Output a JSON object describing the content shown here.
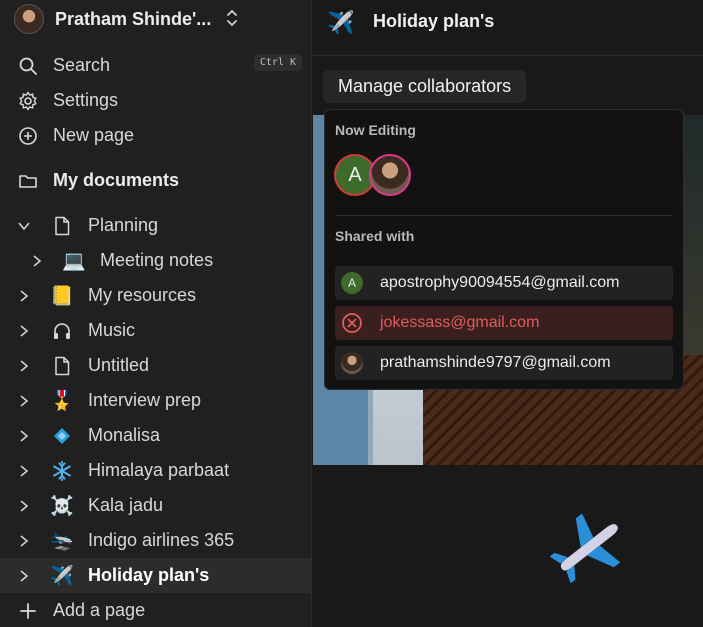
{
  "workspace": {
    "name": "Pratham Shinde'..."
  },
  "nav": {
    "search": "Search",
    "search_shortcut": "Ctrl K",
    "settings": "Settings",
    "new_page": "New page",
    "my_documents": "My documents",
    "add_page": "Add a page"
  },
  "tree": [
    {
      "label": "Planning",
      "icon": "page-icon"
    },
    {
      "label": "Meeting notes",
      "icon": "laptop-icon"
    },
    {
      "label": "My resources",
      "icon": "notebook-icon"
    },
    {
      "label": "Music",
      "icon": "headphones-icon"
    },
    {
      "label": "Untitled",
      "icon": "page-icon"
    },
    {
      "label": "Interview prep",
      "icon": "medal-icon"
    },
    {
      "label": "Monalisa",
      "icon": "diamond-icon"
    },
    {
      "label": "Himalaya parbaat",
      "icon": "snowflake-icon"
    },
    {
      "label": "Kala jadu",
      "icon": "skull-icon"
    },
    {
      "label": "Indigo airlines 365",
      "icon": "landing-icon"
    },
    {
      "label": "Holiday plan's",
      "icon": "airplane-icon",
      "selected": true
    }
  ],
  "page": {
    "title": "Holiday plan's"
  },
  "collab": {
    "button": "Manage collaborators",
    "now_editing": "Now Editing",
    "editor_initial": "A",
    "shared_with": "Shared with",
    "shares": [
      {
        "initial": "A",
        "email": "apostrophy90094554@gmail.com"
      },
      {
        "email": "jokessass@gmail.com",
        "status": "error"
      },
      {
        "email": "prathamshinde9797@gmail.com"
      }
    ]
  },
  "colors": {
    "error": "#e35c5c",
    "avatar_green": "#3d6b2a",
    "accent_pink": "#d93b8c"
  }
}
